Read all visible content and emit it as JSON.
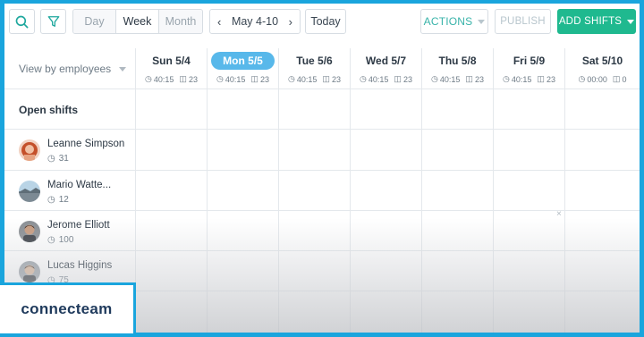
{
  "toolbar": {
    "search_icon": "search-icon",
    "filter_icon": "filter-icon",
    "views": [
      {
        "label": "Day",
        "active": false
      },
      {
        "label": "Week",
        "active": true
      },
      {
        "label": "Month",
        "active": false
      }
    ],
    "date_range": "May 4-10",
    "today_label": "Today",
    "actions_label": "ACTIONS",
    "publish_label": "PUBLISH",
    "add_shifts_label": "ADD SHIFTS"
  },
  "schedule": {
    "view_by_label": "View by employees",
    "days": [
      {
        "label": "Sun 5/4",
        "hours": "40:15",
        "shifts": "23",
        "is_today": false
      },
      {
        "label": "Mon 5/5",
        "hours": "40:15",
        "shifts": "23",
        "is_today": true
      },
      {
        "label": "Tue 5/6",
        "hours": "40:15",
        "shifts": "23",
        "is_today": false
      },
      {
        "label": "Wed 5/7",
        "hours": "40:15",
        "shifts": "23",
        "is_today": false
      },
      {
        "label": "Thu 5/8",
        "hours": "40:15",
        "shifts": "23",
        "is_today": false
      },
      {
        "label": "Fri 5/9",
        "hours": "40:15",
        "shifts": "23",
        "is_today": false
      },
      {
        "label": "Sat 5/10",
        "hours": "00:00",
        "shifts": "0",
        "is_today": false
      }
    ],
    "open_shifts_label": "Open shifts",
    "employees": [
      {
        "name": "Leanne Simpson",
        "hours": "31"
      },
      {
        "name": "Mario Watte...",
        "hours": "12"
      },
      {
        "name": "Jerome Elliott",
        "hours": "100"
      },
      {
        "name": "Lucas Higgins",
        "hours": "75"
      }
    ],
    "remove_mark": "×"
  },
  "brand": {
    "logo_text": "connecteam",
    "accent": "#1aa5dd",
    "primary_green": "#1fb98f",
    "today_blue": "#58b8ea"
  }
}
